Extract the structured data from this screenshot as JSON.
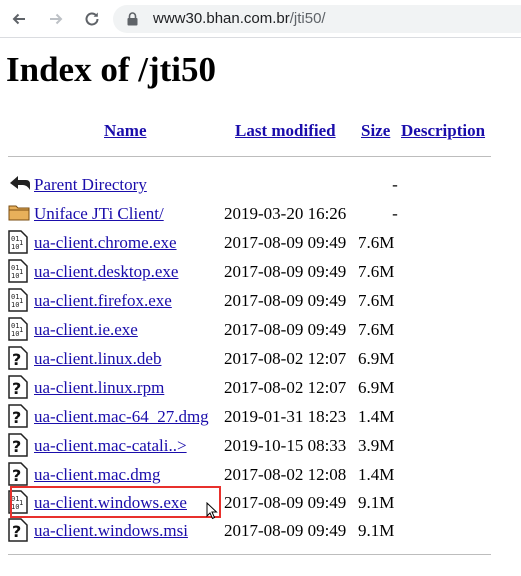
{
  "browser": {
    "url_host": "www30.bhan.com.br",
    "url_path": "/jti50/"
  },
  "page": {
    "title": "Index of /jti50"
  },
  "table": {
    "headers": {
      "name": "Name",
      "last_modified": "Last modified",
      "size": "Size",
      "description": "Description"
    },
    "rows": [
      {
        "icon": "back-arrow-icon",
        "name": "Parent Directory",
        "date": "",
        "size": "-"
      },
      {
        "icon": "folder-icon",
        "name": "Uniface JTi Client/",
        "date": "2019-03-20 16:26",
        "size": "-"
      },
      {
        "icon": "binary-file-icon",
        "name": "ua-client.chrome.exe",
        "date": "2017-08-09 09:49",
        "size": "7.6M"
      },
      {
        "icon": "binary-file-icon",
        "name": "ua-client.desktop.exe",
        "date": "2017-08-09 09:49",
        "size": "7.6M"
      },
      {
        "icon": "binary-file-icon",
        "name": "ua-client.firefox.exe",
        "date": "2017-08-09 09:49",
        "size": "7.6M"
      },
      {
        "icon": "binary-file-icon",
        "name": "ua-client.ie.exe",
        "date": "2017-08-09 09:49",
        "size": "7.6M"
      },
      {
        "icon": "unknown-file-icon",
        "name": "ua-client.linux.deb",
        "date": "2017-08-02 12:07",
        "size": "6.9M"
      },
      {
        "icon": "unknown-file-icon",
        "name": "ua-client.linux.rpm",
        "date": "2017-08-02 12:07",
        "size": "6.9M"
      },
      {
        "icon": "unknown-file-icon",
        "name": "ua-client.mac-64_27.dmg",
        "date": "2019-01-31 18:23",
        "size": "1.4M"
      },
      {
        "icon": "unknown-file-icon",
        "name": "ua-client.mac-catali..>",
        "date": "2019-10-15 08:33",
        "size": "3.9M"
      },
      {
        "icon": "unknown-file-icon",
        "name": "ua-client.mac.dmg",
        "date": "2017-08-02 12:08",
        "size": "1.4M"
      },
      {
        "icon": "binary-file-icon",
        "name": "ua-client.windows.exe",
        "date": "2017-08-09 09:49",
        "size": "9.1M"
      },
      {
        "icon": "unknown-file-icon",
        "name": "ua-client.windows.msi",
        "date": "2017-08-09 09:49",
        "size": "9.1M"
      }
    ]
  },
  "colors": {
    "link": "#1a0dab",
    "highlight_box": "#e8302c"
  }
}
